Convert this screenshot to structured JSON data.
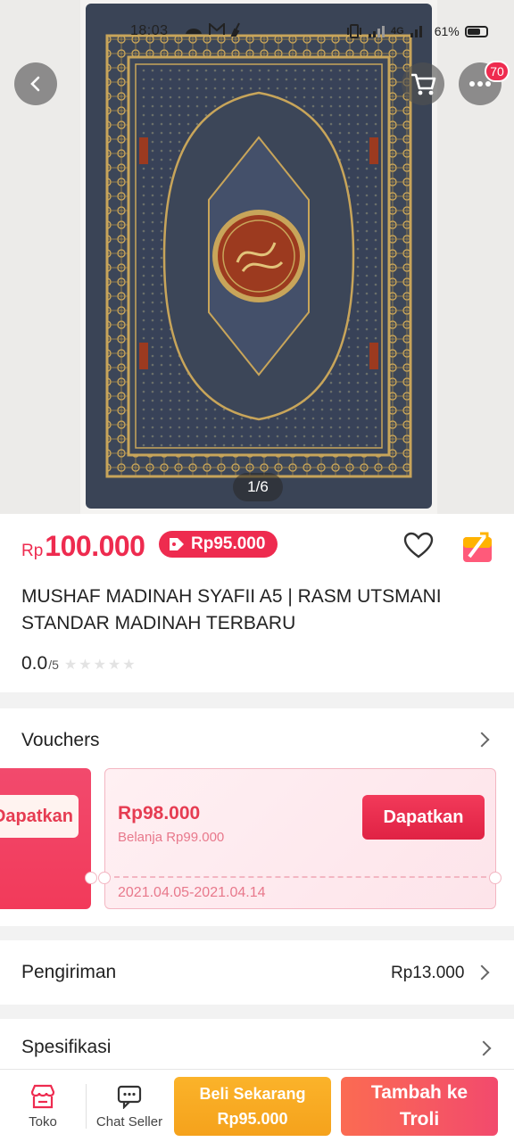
{
  "status_bar": {
    "time": "18:03",
    "network": "4G",
    "battery": "61%"
  },
  "header": {
    "cart_badge": "70"
  },
  "gallery": {
    "counter": "1/6"
  },
  "price": {
    "currency": "Rp",
    "amount": "100.000",
    "promo": "Rp95.000"
  },
  "product": {
    "title": "MUSHAF MADINAH SYAFII A5 | RASM UTSMANI STANDAR MADINAH TERBARU",
    "rating": "0.0",
    "rating_max": "/5"
  },
  "vouchers": {
    "heading": "Vouchers",
    "left_button": "Dapatkan",
    "card": {
      "value": "Rp98.000",
      "min_spend": "Belanja Rp99.000",
      "button": "Dapatkan",
      "validity": "2021.04.05-2021.04.14"
    }
  },
  "shipping": {
    "heading": "Pengiriman",
    "price": "Rp13.000"
  },
  "spec": {
    "heading": "Spesifikasi"
  },
  "bottom_bar": {
    "shop": "Toko",
    "chat": "Chat Seller",
    "buy_line1": "Beli Sekarang",
    "buy_line2": "Rp95.000",
    "cart_line1": "Tambah ke",
    "cart_line2": "Troli"
  },
  "colors": {
    "accent": "#ee2b4f",
    "buy": "#f5a21c",
    "cover": "#3c4658",
    "gold": "#c8a55a"
  }
}
